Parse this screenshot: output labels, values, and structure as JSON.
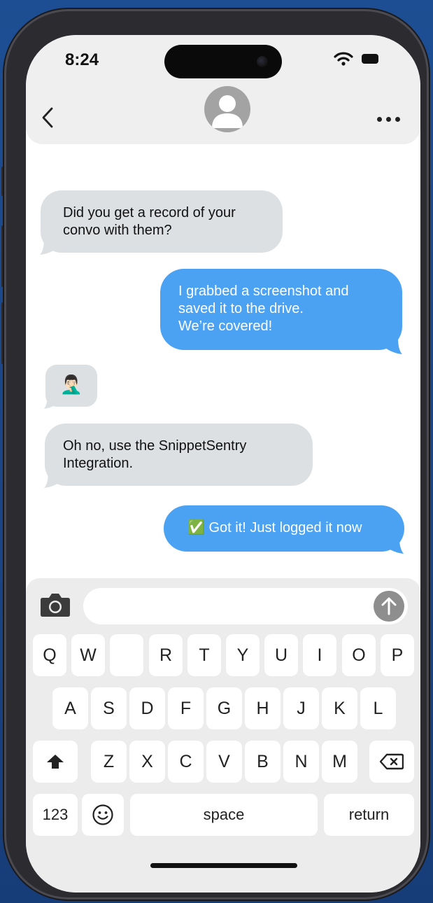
{
  "status_bar": {
    "time": "8:24"
  },
  "messages": [
    {
      "side": "received",
      "text": "Did you get a record of your\nconvo with them?"
    },
    {
      "side": "sent",
      "text": "I grabbed a screenshot and\nsaved it to the drive.\nWe’re covered!"
    },
    {
      "side": "received",
      "text": "🤦🏻‍♂️"
    },
    {
      "side": "received",
      "text": "Oh no, use the SnippetSentry\nIntegration."
    },
    {
      "side": "sent",
      "text": "✅ Got it! Just logged it now"
    }
  ],
  "input": {
    "placeholder": ""
  },
  "keyboard": {
    "row1": [
      "Q",
      "W",
      "",
      "R",
      "T",
      "Y",
      "U",
      "I",
      "O",
      "P"
    ],
    "row2": [
      "A",
      "S",
      "D",
      "F",
      "G",
      "H",
      "J",
      "K",
      "L"
    ],
    "row3": [
      "Z",
      "X",
      "C",
      "V",
      "B",
      "N",
      "M"
    ],
    "numbers_label": "123",
    "space_label": "space",
    "return_label": "return"
  },
  "colors": {
    "sent_bubble": "#4ba2f2",
    "received_bubble": "#dde0e3",
    "background": "#1c4a8c"
  }
}
